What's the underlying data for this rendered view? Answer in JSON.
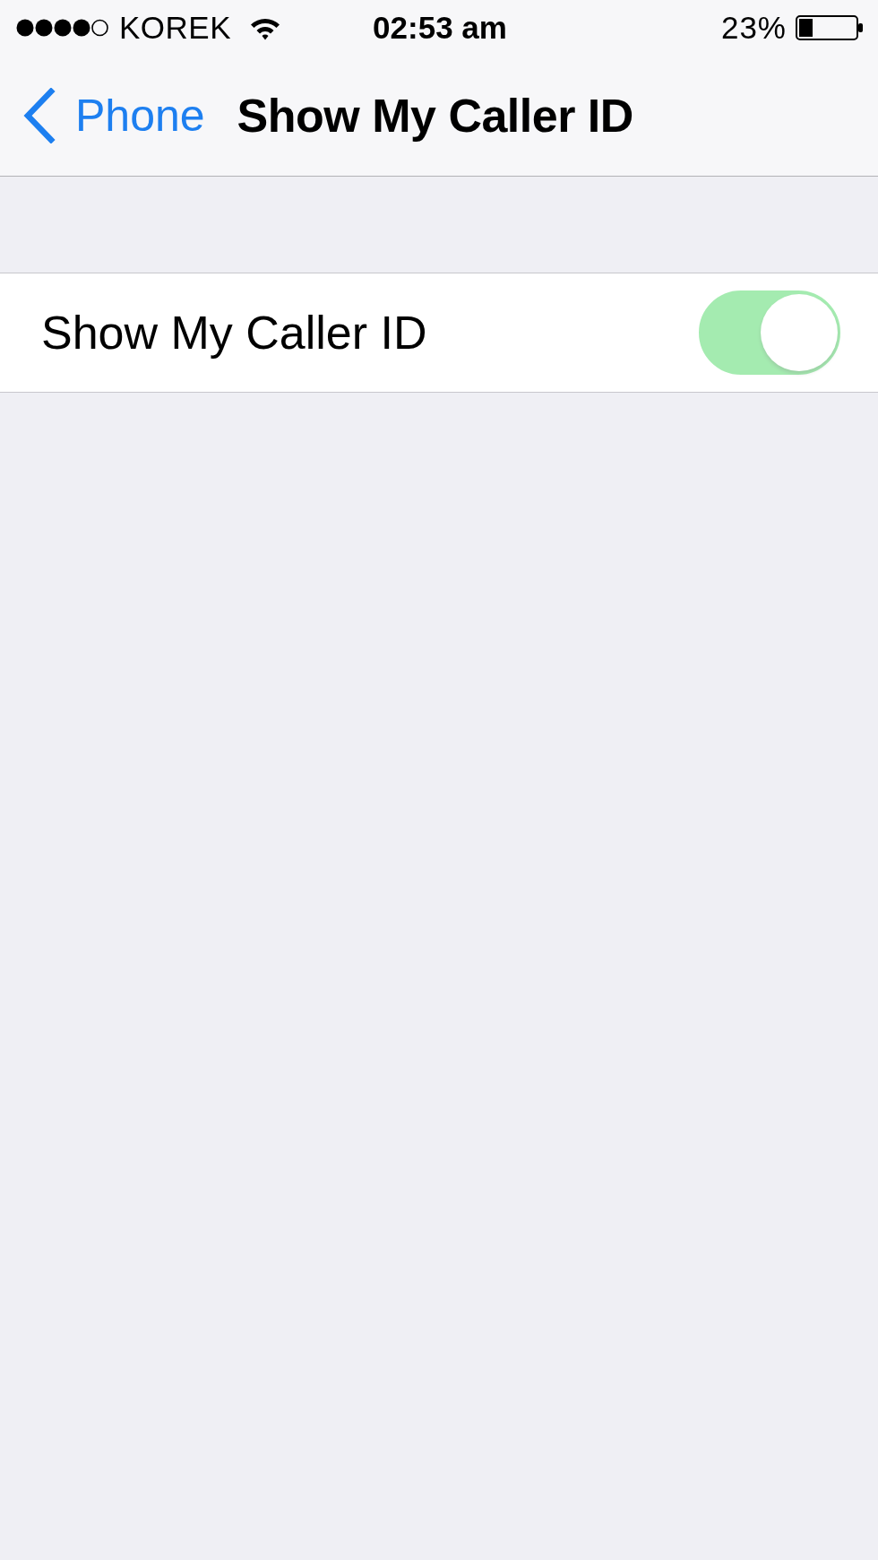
{
  "status_bar": {
    "carrier": "KOREK",
    "time": "02:53 am",
    "battery_percent": "23%"
  },
  "nav_bar": {
    "back_label": "Phone",
    "title": "Show My Caller ID"
  },
  "settings": [
    {
      "kind": "toggle",
      "label": "Show My Caller ID",
      "on": true,
      "disabled": true
    }
  ]
}
